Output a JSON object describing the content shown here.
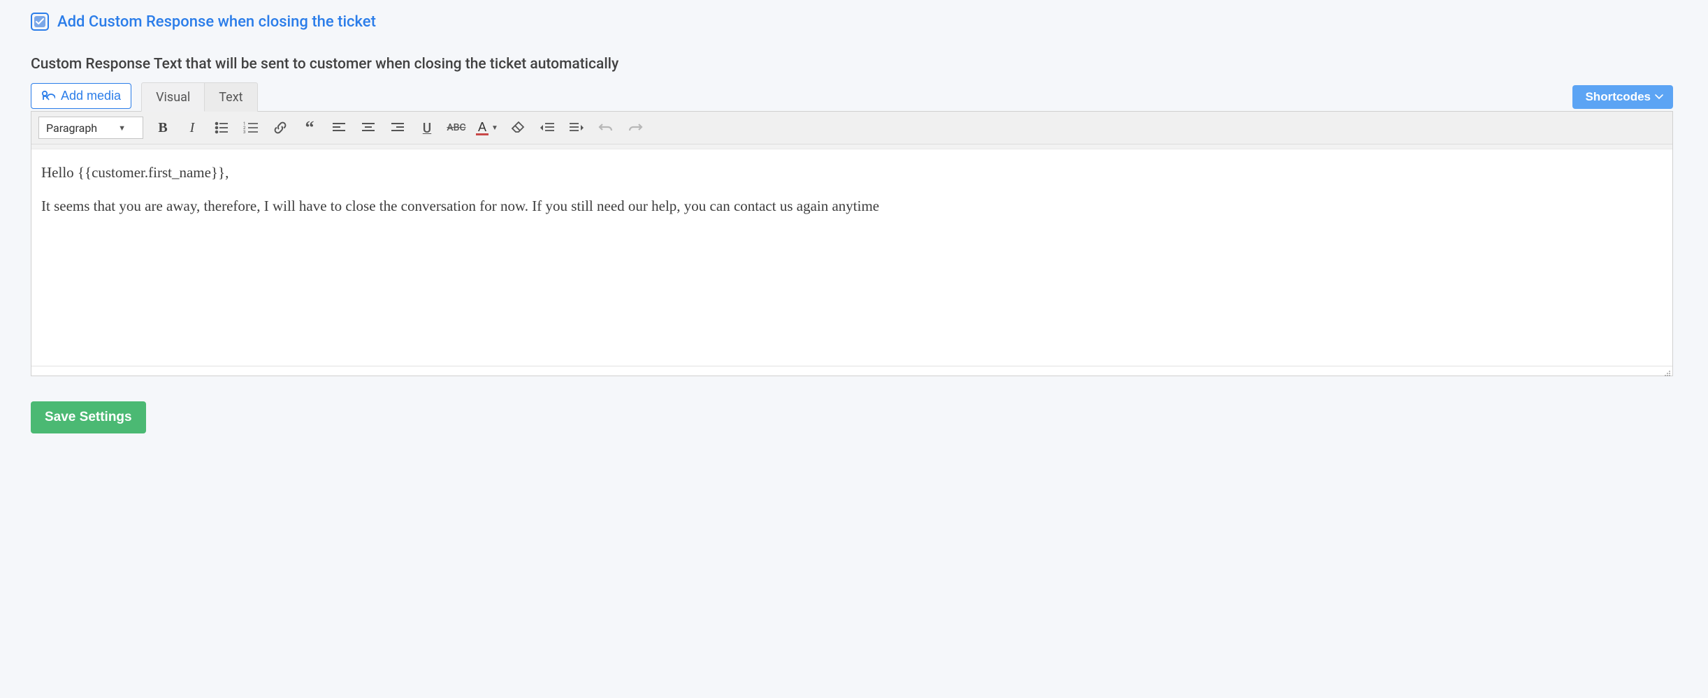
{
  "checkbox": {
    "checked": true,
    "label": "Add Custom Response when closing the ticket"
  },
  "section_label": "Custom Response Text that will be sent to customer when closing the ticket automatically",
  "add_media_label": "Add media",
  "tabs": {
    "visual": "Visual",
    "text": "Text"
  },
  "shortcodes_label": "Shortcodes",
  "format_select": "Paragraph",
  "editor_content": {
    "line1": "Hello {{customer.first_name}},",
    "line2": "It seems that you are away, therefore, I will have to close the conversation for now. If you still need our help, you can contact us again anytime"
  },
  "save_label": "Save Settings",
  "toolbar_icons": {
    "bold": "bold",
    "italic": "italic",
    "ulist": "bulleted-list",
    "olist": "numbered-list",
    "link": "link",
    "quote": "blockquote",
    "align_left": "align-left",
    "align_center": "align-center",
    "align_right": "align-right",
    "underline": "underline",
    "strike": "strikethrough",
    "textcolor": "text-color",
    "clear": "clear-formatting",
    "outdent": "outdent",
    "indent": "indent",
    "undo": "undo",
    "redo": "redo"
  }
}
